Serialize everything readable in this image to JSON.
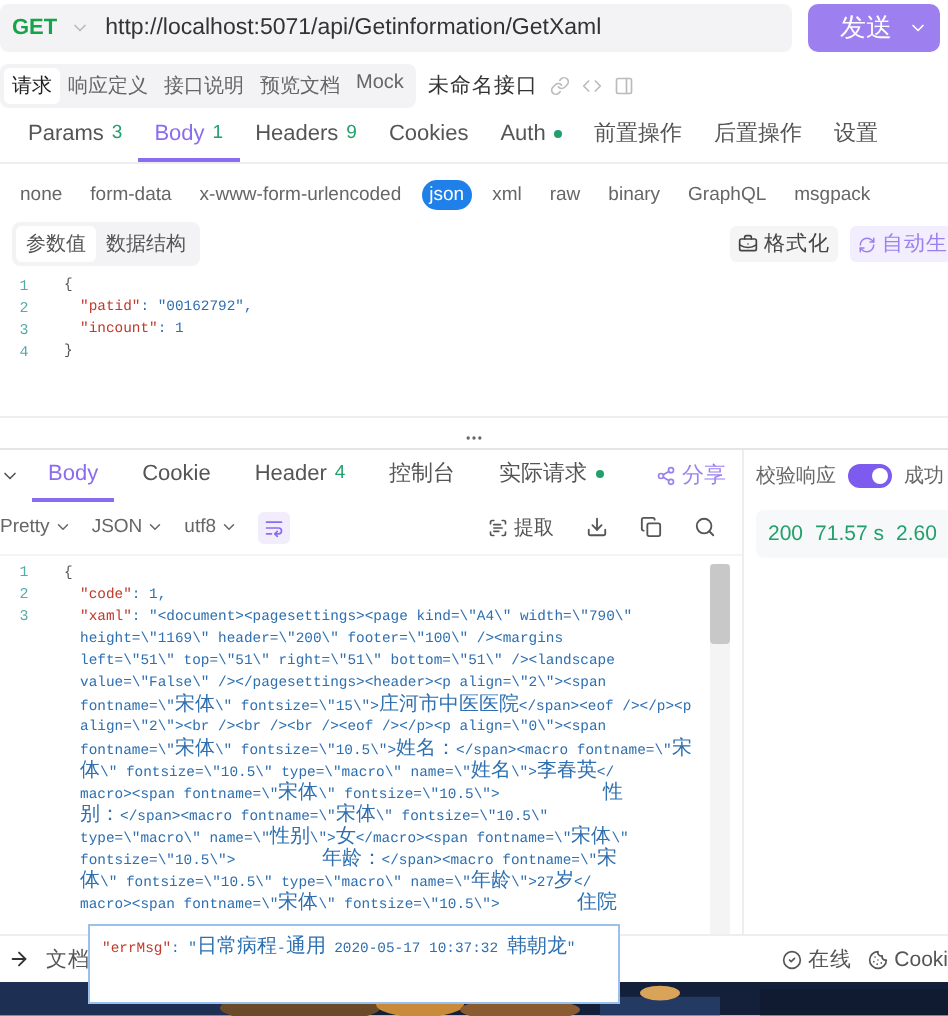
{
  "request": {
    "method": "GET",
    "url": "http://localhost:5071/api/Getinformation/GetXaml",
    "send_label": "发送"
  },
  "subtabs": [
    {
      "label": "请求",
      "selected": true
    },
    {
      "label": "响应定义",
      "selected": false
    },
    {
      "label": "接口说明",
      "selected": false
    },
    {
      "label": "预览文档",
      "selected": false
    },
    {
      "label": "Mock",
      "selected": false
    }
  ],
  "api_name": "未命名接口",
  "request_tabs": [
    {
      "label": "Params",
      "count": "3",
      "selected": false
    },
    {
      "label": "Body",
      "count": "1",
      "selected": true
    },
    {
      "label": "Headers",
      "count": "9",
      "selected": false
    },
    {
      "label": "Cookies",
      "selected": false
    },
    {
      "label": "Auth",
      "dot": true,
      "selected": false
    },
    {
      "label": "前置操作",
      "selected": false
    },
    {
      "label": "后置操作",
      "selected": false
    },
    {
      "label": "设置",
      "selected": false
    }
  ],
  "body_types": [
    {
      "label": "none",
      "selected": false
    },
    {
      "label": "form-data",
      "selected": false
    },
    {
      "label": "x-www-form-urlencoded",
      "selected": false
    },
    {
      "label": "json",
      "selected": true
    },
    {
      "label": "xml",
      "selected": false
    },
    {
      "label": "raw",
      "selected": false
    },
    {
      "label": "binary",
      "selected": false
    },
    {
      "label": "GraphQL",
      "selected": false
    },
    {
      "label": "msgpack",
      "selected": false
    }
  ],
  "view_modes": [
    {
      "label": "参数值",
      "selected": true
    },
    {
      "label": "数据结构",
      "selected": false
    }
  ],
  "format_button": "格式化",
  "autogen_button": "自动生",
  "request_body": [
    {
      "num": "1",
      "kind": "punct",
      "text": "{"
    },
    {
      "num": "2",
      "kind": "pair",
      "key": "\"patid\"",
      "value": ": \"00162792\","
    },
    {
      "num": "3",
      "kind": "pair",
      "key": "\"incount\"",
      "value": ": 1"
    },
    {
      "num": "4",
      "kind": "punct",
      "text": "}"
    }
  ],
  "response_tabs": [
    {
      "label": "Body",
      "selected": true
    },
    {
      "label": "Cookie",
      "selected": false
    },
    {
      "label": "Header",
      "count": "4",
      "selected": false
    },
    {
      "label": "控制台",
      "selected": false
    },
    {
      "label": "实际请求",
      "dot": true,
      "selected": false
    }
  ],
  "share_label": "分享",
  "response_toolbar": {
    "format": "Pretty",
    "language": "JSON",
    "encoding": "utf8",
    "extract": "提取"
  },
  "response_body": [
    {
      "num": "1",
      "kind": "punct",
      "text": "{"
    },
    {
      "num": "2",
      "kind": "pair",
      "key": "\"code\"",
      "value": ": 1,"
    },
    {
      "num": "3",
      "kind": "pair",
      "key": "\"xaml\"",
      "value": ": \"<document><pagesettings><page kind=\\\"A4\\\" width=\\\"790\\\""
    },
    {
      "kind": "cont",
      "text": "height=\\\"1169\\\" header=\\\"200\\\" footer=\\\"100\\\" /><margins"
    },
    {
      "kind": "cont",
      "text": "left=\\\"51\\\" top=\\\"51\\\" right=\\\"51\\\" bottom=\\\"51\\\" /><landscape"
    },
    {
      "kind": "cont",
      "text": "value=\\\"False\\\" /></pagesettings><header><p align=\\\"2\\\"><span"
    },
    {
      "kind": "cont",
      "text": "fontname=\\\"宋体\\\" fontsize=\\\"15\\\">庄河市中医医院</span><eof /></p><p"
    },
    {
      "kind": "cont",
      "text": "align=\\\"2\\\"><br /><br /><br /><eof /></p><p align=\\\"0\\\"><span"
    },
    {
      "kind": "cont",
      "text": "fontname=\\\"宋体\\\" fontsize=\\\"10.5\\\">姓名：</span><macro fontname=\\\"宋"
    },
    {
      "kind": "cont",
      "text": "体\\\" fontsize=\\\"10.5\\\" type=\\\"macro\\\" name=\\\"姓名\\\">李春英</"
    },
    {
      "kind": "cont",
      "text": "macro><span fontname=\\\"宋体\\\" fontsize=\\\"10.5\\\">            性"
    },
    {
      "kind": "cont",
      "text": "别：</span><macro fontname=\\\"宋体\\\" fontsize=\\\"10.5\\\""
    },
    {
      "kind": "cont",
      "text": "type=\\\"macro\\\" name=\\\"性别\\\">女</macro><span fontname=\\\"宋体\\\""
    },
    {
      "kind": "cont",
      "text": "fontsize=\\\"10.5\\\">          年龄：</span><macro fontname=\\\"宋"
    },
    {
      "kind": "cont",
      "text": "体\\\" fontsize=\\\"10.5\\\" type=\\\"macro\\\" name=\\\"年龄\\\">27岁</"
    },
    {
      "kind": "cont",
      "text": "macro><span fontname=\\\"宋体\\\" fontsize=\\\"10.5\\\">         住院"
    }
  ],
  "tooltip": {
    "key": "\"errMsg\"",
    "value": ": \"日常病程-通用 2020-05-17 10:37:32 韩朝龙\""
  },
  "validate": {
    "label": "校验响应",
    "on": true,
    "result": "成功"
  },
  "status": {
    "code": "200",
    "time": "71.57 s",
    "size": "2.60"
  },
  "footer": {
    "docs": "文档",
    "online": "在线",
    "cookie": "Cooki"
  }
}
